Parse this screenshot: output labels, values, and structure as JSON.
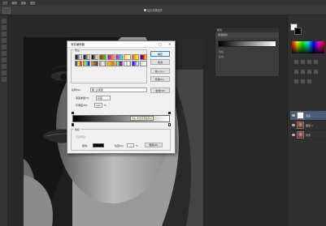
{
  "menubar": {
    "items": [
      "文件",
      "编辑",
      "图像",
      "图层"
    ]
  },
  "options": {
    "checkbox_label": "显示变换控件"
  },
  "nav_panel": {
    "header": "属性",
    "tab": "渐变映射",
    "rows": [
      "仿色",
      "反向"
    ]
  },
  "layers": [
    {
      "name": "渐变...",
      "thumb": "white"
    },
    {
      "name": "图层 1",
      "thumb": "face"
    },
    {
      "name": "背景",
      "thumb": "face"
    }
  ],
  "dialog": {
    "title": "渐变编辑器",
    "presets_label": "预设",
    "buttons": [
      "确定",
      "取消",
      "载入(L)...",
      "存储(S)..."
    ],
    "new_button": "新建(W)",
    "name_label": "名称(N):",
    "name_value": "黑, 白渐变",
    "type_label": "渐变类型(T):",
    "type_value": "实底",
    "smooth_label": "平滑度(M):",
    "smooth_value": "100",
    "smooth_unit": "%",
    "tooltip": "色标:单击可添加色标",
    "stops_label": "色标",
    "opacity_label": "不透明度:",
    "color_label": "颜色:",
    "location_label": "位置(C):",
    "location_unit": "%",
    "delete_label": "删除(D)"
  },
  "colors": {
    "accent": "#3c7fb1",
    "selected_layer": "#4a5d78"
  }
}
